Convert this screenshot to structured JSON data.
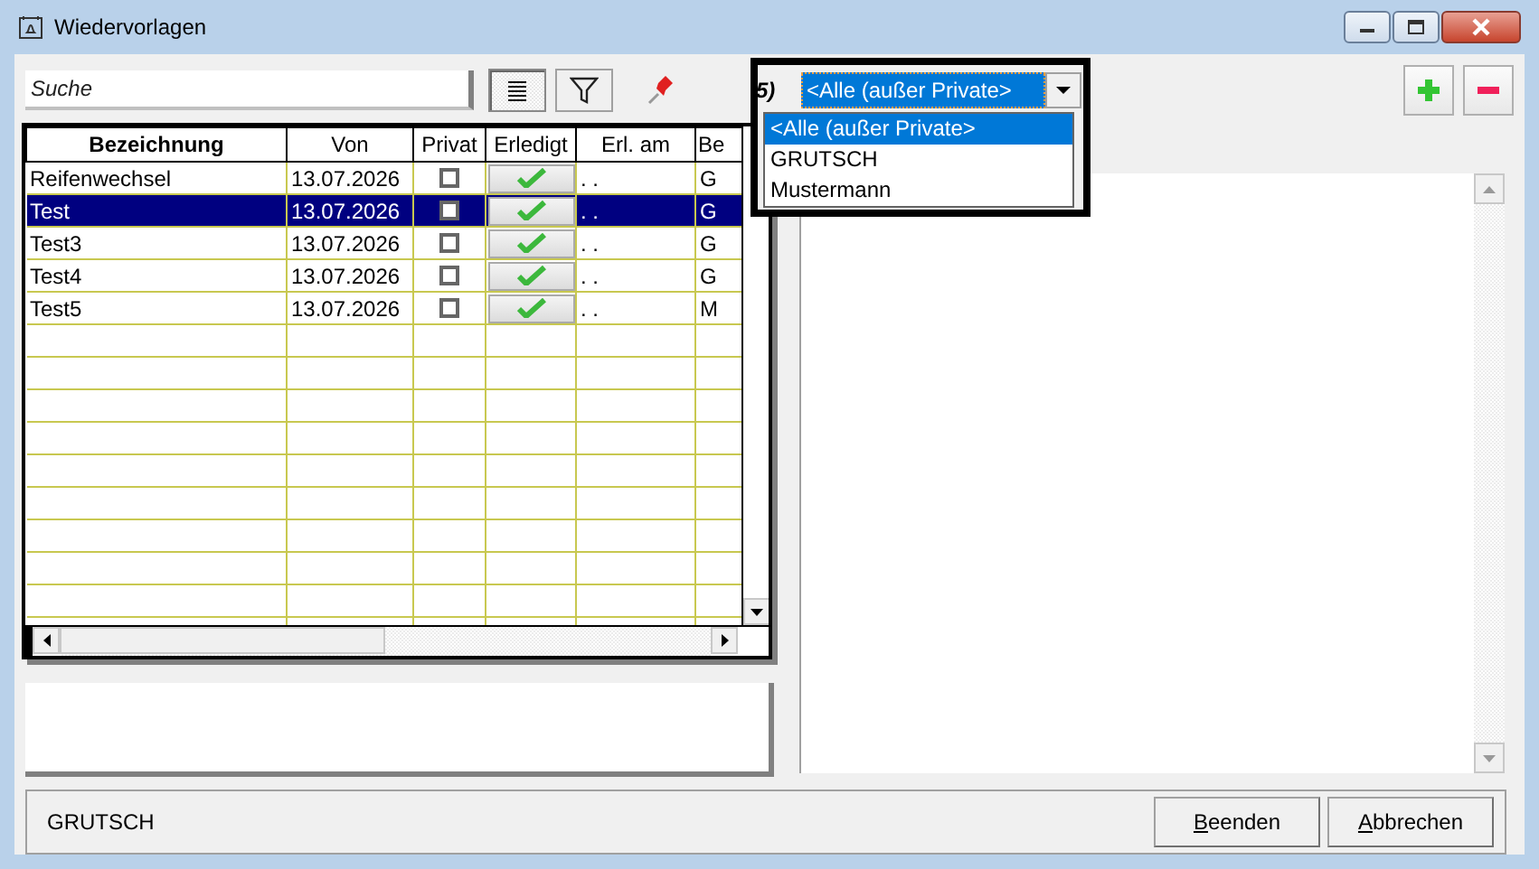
{
  "window": {
    "title": "Wiedervorlagen"
  },
  "toolbar": {
    "search": {
      "placeholder": "Suche"
    },
    "buttons": [
      {
        "kind": "list",
        "pressed": true
      },
      {
        "kind": "filter",
        "pressed": false
      },
      {
        "kind": "pin",
        "pressed": false
      }
    ],
    "add_remove": [
      {
        "kind": "add"
      },
      {
        "kind": "remove"
      }
    ]
  },
  "user_filter": {
    "count_label": "5)",
    "value": "<Alle (außer Private>",
    "open": true,
    "options": [
      {
        "label": "<Alle (außer Private>",
        "selected": true
      },
      {
        "label": "GRUTSCH",
        "selected": false
      },
      {
        "label": "Mustermann",
        "selected": false
      }
    ]
  },
  "table": {
    "columns": [
      "Bezeichnung",
      "Von",
      "Privat",
      "Erledigt",
      "Erl. am",
      "Be"
    ],
    "rows": [
      {
        "name": "Reifenwechsel",
        "from": "13.07.2026",
        "private": false,
        "done_at": ". .",
        "column_6": "G",
        "selected": false
      },
      {
        "name": "Test",
        "from": "13.07.2026",
        "private": false,
        "done_at": ". .",
        "column_6": "G",
        "selected": true
      },
      {
        "name": "Test3",
        "from": "13.07.2026",
        "private": false,
        "done_at": ". .",
        "column_6": "G",
        "selected": false
      },
      {
        "name": "Test4",
        "from": "13.07.2026",
        "private": false,
        "done_at": ". .",
        "column_6": "G",
        "selected": false
      },
      {
        "name": "Test5",
        "from": "13.07.2026",
        "private": false,
        "done_at": ". .",
        "column_6": "M",
        "selected": false
      }
    ]
  },
  "status": {
    "user": "GRUTSCH"
  },
  "buttons": [
    {
      "label": "Beenden"
    },
    {
      "label": "Abbrechen"
    }
  ]
}
